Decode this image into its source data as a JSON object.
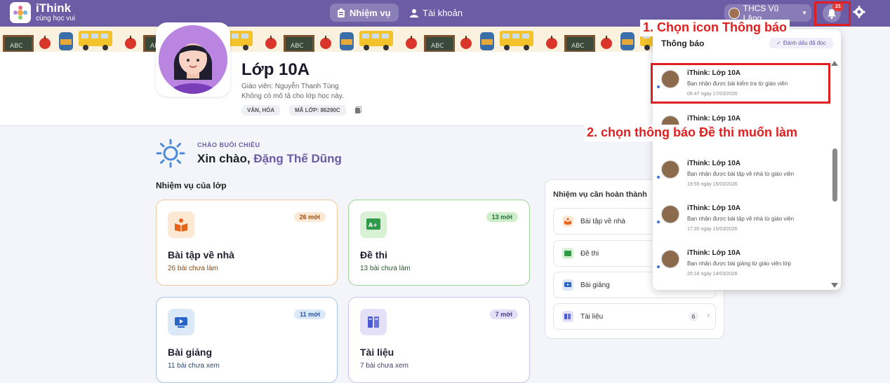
{
  "app": {
    "name": "iThink",
    "tagline": "cùng học vui"
  },
  "nav": {
    "tab_tasks": "Nhiệm vụ",
    "tab_account": "Tài khoản"
  },
  "header": {
    "school": "THCS Vũ Lăng",
    "notification_count": "21"
  },
  "class": {
    "title": "Lớp 10A",
    "teacher": "Giáo viên: Nguyễn Thanh Tùng",
    "description": "Không có mô tả cho lớp học này.",
    "subject_chip": "VĂN, HÓA",
    "code_chip": "MÃ LỚP: 86290C"
  },
  "greeting": {
    "small": "CHÀO BUỔI CHIỀU",
    "hello": "Xin chào,",
    "name": "Đặng Thế Dũng"
  },
  "section_title": "Nhiệm vụ của lớp",
  "cards": [
    {
      "title": "Bài tập về nhà",
      "sub": "26 bài chưa làm",
      "badge": "26 mới",
      "icon": "book-reader-icon"
    },
    {
      "title": "Đề thi",
      "sub": "13 bài chưa làm",
      "badge": "13 mới",
      "icon": "exam-grade-icon"
    },
    {
      "title": "Bài giảng",
      "sub": "11 bài chưa xem",
      "badge": "11 mới",
      "icon": "video-icon"
    },
    {
      "title": "Tài liệu",
      "sub": "7 bài chưa xem",
      "badge": "7 mới",
      "icon": "documents-icon"
    }
  ],
  "task_panel": {
    "title": "Nhiệm vụ cần hoàn thành",
    "rows": [
      {
        "label": "Bài tập về nhà"
      },
      {
        "label": "Đề thi"
      },
      {
        "label": "Bài giảng"
      },
      {
        "label": "Tài liệu",
        "count": "6"
      }
    ]
  },
  "notifications": {
    "title": "Thông báo",
    "mark_read": "Đánh dấu đã đọc",
    "items": [
      {
        "title": "iThink: Lớp 10A",
        "body": "Bạn nhận được bài kiểm tra từ giáo viên",
        "time": "06:47 ngày 17/03/2026"
      },
      {
        "title": "iThink: Lớp 10A",
        "body": "",
        "time": ""
      },
      {
        "title": "iThink: Lớp 10A",
        "body": "Bạn nhận được bài tập về nhà từ giáo viên",
        "time": "19:55 ngày 15/03/2026"
      },
      {
        "title": "iThink: Lớp 10A",
        "body": "Bạn nhận được bài tập về nhà từ giáo viên",
        "time": "17:30 ngày 15/03/2026"
      },
      {
        "title": "iThink: Lớp 10A",
        "body": "Bạn nhận được bài giảng từ giáo viên lớp",
        "time": "20:18 ngày 14/03/2026"
      }
    ]
  },
  "annotations": {
    "step1": "1. Chọn icon Thông báo",
    "step2": "2. chọn thông báo Đề thi muốn làm"
  },
  "banner_glyphs": {
    "slate": "ABC"
  },
  "colors": {
    "primary": "#6b5ca5",
    "highlight": "#e02020"
  }
}
